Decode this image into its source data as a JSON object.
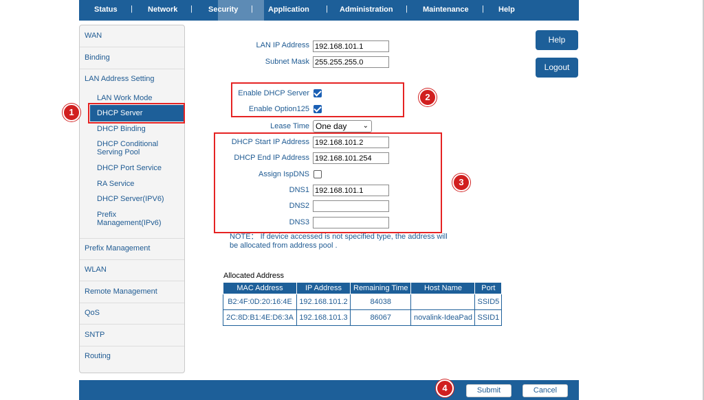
{
  "nav": {
    "items": [
      "Status",
      "Network",
      "Security",
      "Application",
      "Administration",
      "Maintenance",
      "Help"
    ],
    "active": "Network"
  },
  "sidebar": {
    "wan": "WAN",
    "binding": "Binding",
    "lan_address_setting": "LAN Address Setting",
    "sub": [
      "LAN Work Mode",
      "DHCP Server",
      "DHCP Binding",
      "DHCP Conditional Serving Pool",
      "DHCP Port Service",
      "RA Service",
      "DHCP Server(IPV6)",
      "Prefix Management(IPv6)"
    ],
    "prefix_management": "Prefix Management",
    "wlan": "WLAN",
    "remote_management": "Remote Management",
    "qos": "QoS",
    "sntp": "SNTP",
    "routing": "Routing"
  },
  "form": {
    "lan_ip_label": "LAN IP Address",
    "lan_ip_value": "192.168.101.1",
    "subnet_label": "Subnet Mask",
    "subnet_value": "255.255.255.0",
    "enable_dhcp_label": "Enable DHCP Server",
    "enable_dhcp_checked": true,
    "enable_option125_label": "Enable Option125",
    "enable_option125_checked": true,
    "lease_time_label": "Lease Time",
    "lease_time_value": "One day",
    "dhcp_start_label": "DHCP Start IP Address",
    "dhcp_start_value": "192.168.101.2",
    "dhcp_end_label": "DHCP End IP Address",
    "dhcp_end_value": "192.168.101.254",
    "assign_ispdns_label": "Assign IspDNS",
    "assign_ispdns_checked": false,
    "dns1_label": "DNS1",
    "dns1_value": "192.168.101.1",
    "dns2_label": "DNS2",
    "dns2_value": "",
    "dns3_label": "DNS3",
    "dns3_value": "",
    "note": "NOTE： If device accessed is not specified type, the address will be allocated from address pool ."
  },
  "buttons": {
    "help": "Help",
    "logout": "Logout",
    "submit": "Submit",
    "cancel": "Cancel"
  },
  "allocated": {
    "title": "Allocated Address",
    "headers": [
      "MAC Address",
      "IP Address",
      "Remaining Time",
      "Host Name",
      "Port"
    ],
    "rows": [
      [
        "B2:4F:0D:20:16:4E",
        "192.168.101.2",
        "84038",
        "",
        "SSID5"
      ],
      [
        "2C:8D:B1:4E:D6:3A",
        "192.168.101.3",
        "86067",
        "novalink-IdeaPad",
        "SSID1"
      ]
    ]
  },
  "annotations": {
    "badges": [
      "1",
      "2",
      "3",
      "4"
    ],
    "color": "#e52222"
  },
  "colors": {
    "brand_blue": "#1d5f99",
    "link_blue": "#1e5a92",
    "nav_active": "#5d8bb5"
  }
}
